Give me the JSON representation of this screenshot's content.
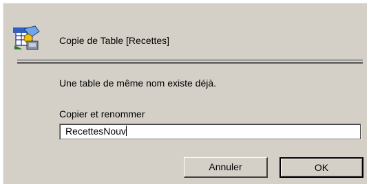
{
  "dialog": {
    "title": "Copie de Table [Recettes]",
    "icon": "table-copy-icon",
    "message": "Une table de même nom existe déjà.",
    "field_label": "Copier et renommer",
    "input_value": "RecettesNouv",
    "buttons": {
      "cancel_label": "Annuler",
      "ok_label": "OK"
    }
  },
  "colors": {
    "dialog_background": "#d4d0c8",
    "input_background": "#ffffff",
    "text": "#000000"
  }
}
